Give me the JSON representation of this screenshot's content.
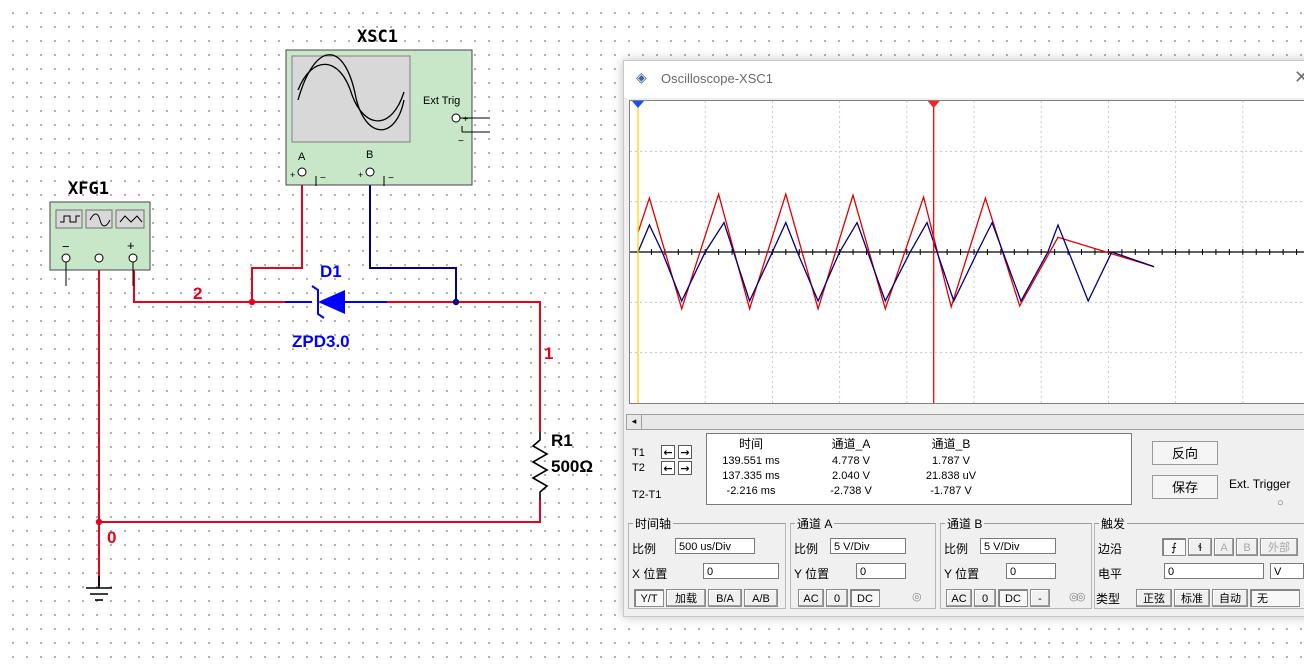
{
  "schematic": {
    "components": {
      "oscilloscope_label": "XSC1",
      "ext_trig_label": "Ext Trig",
      "channel_a_label": "A",
      "channel_b_label": "B",
      "plus_sign": "+",
      "minus_sign": "−",
      "function_generator_label": "XFG1",
      "diode_label": "D1",
      "diode_model": "ZPD3.0",
      "resistor_label": "R1",
      "resistor_value": "500Ω"
    },
    "nets": {
      "node_2": "2",
      "node_1": "1",
      "node_0": "0"
    },
    "colors": {
      "wire_red": "#e8001c",
      "wire_blue": "#00008b",
      "diode_blue": "#0000ff",
      "instrument_green": "#c8e6c8"
    }
  },
  "scope_window": {
    "title": "Oscilloscope-XSC1",
    "close_icon": "close-icon",
    "app_icon": "oscilloscope-icon",
    "readout": {
      "headers": [
        "时间",
        "通道_A",
        "通道_B"
      ],
      "t1_label": "T1",
      "t2_label": "T2",
      "t2t1_label": "T2-T1",
      "rows": [
        {
          "time": "139.551 ms",
          "a": "4.778 V",
          "b": "1.787 V"
        },
        {
          "time": "137.335 ms",
          "a": "2.040 V",
          "b": "21.838 uV"
        },
        {
          "time": "-2.216 ms",
          "a": "-2.738 V",
          "b": "-1.787 V"
        }
      ]
    },
    "reverse_button": "反向",
    "save_button": "保存",
    "ext_trigger_label": "Ext. Trigger",
    "timebase": {
      "title": "时间轴",
      "scale_label": "比例",
      "scale_value": "500 us/Div",
      "xpos_label": "X 位置",
      "xpos_value": "0",
      "buttons": [
        "Y/T",
        "加载",
        "B/A",
        "A/B"
      ]
    },
    "channel_a": {
      "title": "通道 A",
      "scale_label": "比例",
      "scale_value": "5  V/Div",
      "ypos_label": "Y 位置",
      "ypos_value": "0",
      "buttons": [
        "AC",
        "0",
        "DC"
      ]
    },
    "channel_b": {
      "title": "通道 B",
      "scale_label": "比例",
      "scale_value": "5  V/Div",
      "ypos_label": "Y 位置",
      "ypos_value": "0",
      "buttons": [
        "AC",
        "0",
        "DC",
        "-"
      ]
    },
    "trigger": {
      "title": "触发",
      "edge_label": "边沿",
      "edge_buttons": [
        "A",
        "B",
        "外部"
      ],
      "level_label": "电平",
      "level_value": "0",
      "level_unit": "V",
      "type_label": "类型",
      "type_buttons": [
        "正弦",
        "标准",
        "自动",
        "无"
      ]
    },
    "trace_colors": {
      "channel_a": "#e00000",
      "channel_b": "#000080",
      "cursor_1": "#ffd700",
      "cursor_2": "#ff0000"
    },
    "chart_data": {
      "type": "line",
      "x_unit": "div",
      "xlim": [
        0,
        10
      ],
      "ylim": [
        -3,
        3
      ],
      "series": [
        {
          "name": "通道_A",
          "x": [
            0,
            0.17,
            0.65,
            1.2,
            1.66,
            2.2,
            2.68,
            3.2,
            3.68,
            4.25,
            4.66,
            5.17,
            5.68,
            6.25,
            7.68
          ],
          "y": [
            0.4,
            1.1,
            -1.16,
            1.18,
            -1.16,
            1.18,
            -1.16,
            1.16,
            -1.16,
            1.12,
            -1.12,
            1.1,
            -1.1,
            0.3,
            -0.3
          ]
        },
        {
          "name": "通道_B",
          "x": [
            0,
            0.17,
            0.36,
            0.65,
            1.0,
            1.28,
            1.66,
            2.0,
            2.2,
            2.37,
            2.68,
            3.0,
            3.26,
            3.68,
            4.05,
            4.3,
            4.7,
            5.05,
            5.27,
            5.7,
            6.1,
            6.25,
            6.7,
            7.05,
            7.68
          ],
          "y": [
            0.0,
            0.55,
            0.0,
            -1.0,
            0.0,
            0.6,
            -1.0,
            0.0,
            0.6,
            0.0,
            -1.0,
            0.0,
            0.6,
            -1.0,
            0.0,
            0.6,
            -1.0,
            0.0,
            0.6,
            -1.0,
            0.0,
            0.55,
            -1.0,
            0.0,
            -0.3
          ]
        }
      ],
      "cursors": [
        {
          "name": "T1",
          "x": 0
        },
        {
          "name": "T2",
          "x": 4.4
        }
      ],
      "grid": true,
      "title": "",
      "xlabel": "",
      "ylabel": ""
    }
  }
}
